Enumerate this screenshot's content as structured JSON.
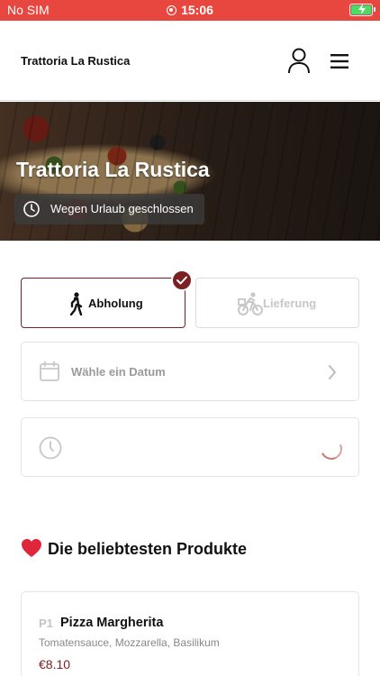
{
  "status_bar": {
    "carrier": "No SIM",
    "time": "15:06",
    "colors": {
      "background": "#e8473f",
      "battery": "#4cd964"
    }
  },
  "header": {
    "title": "Trattoria La Rustica",
    "icons": {
      "account": "user-icon",
      "menu": "hamburger-menu-icon"
    }
  },
  "hero": {
    "title": "Trattoria La Rustica",
    "status_text": "Wegen Urlaub geschlossen",
    "status_icon": "clock-icon"
  },
  "order_mode": {
    "pickup_label": "Abholung",
    "delivery_label": "Lieferung",
    "selected": "pickup",
    "accent_color": "#7a1f22"
  },
  "date_picker": {
    "placeholder": "Wähle ein Datum",
    "icon": "calendar-icon"
  },
  "time_picker": {
    "placeholder": "",
    "icon": "clock-icon",
    "loading": true
  },
  "popular": {
    "emoji": "❤️",
    "title": "Die beliebtesten Produkte",
    "products": [
      {
        "code": "P1",
        "name": "Pizza Margherita",
        "description": "Tomatensauce, Mozzarella, Basilikum",
        "price": "€8.10"
      }
    ]
  }
}
